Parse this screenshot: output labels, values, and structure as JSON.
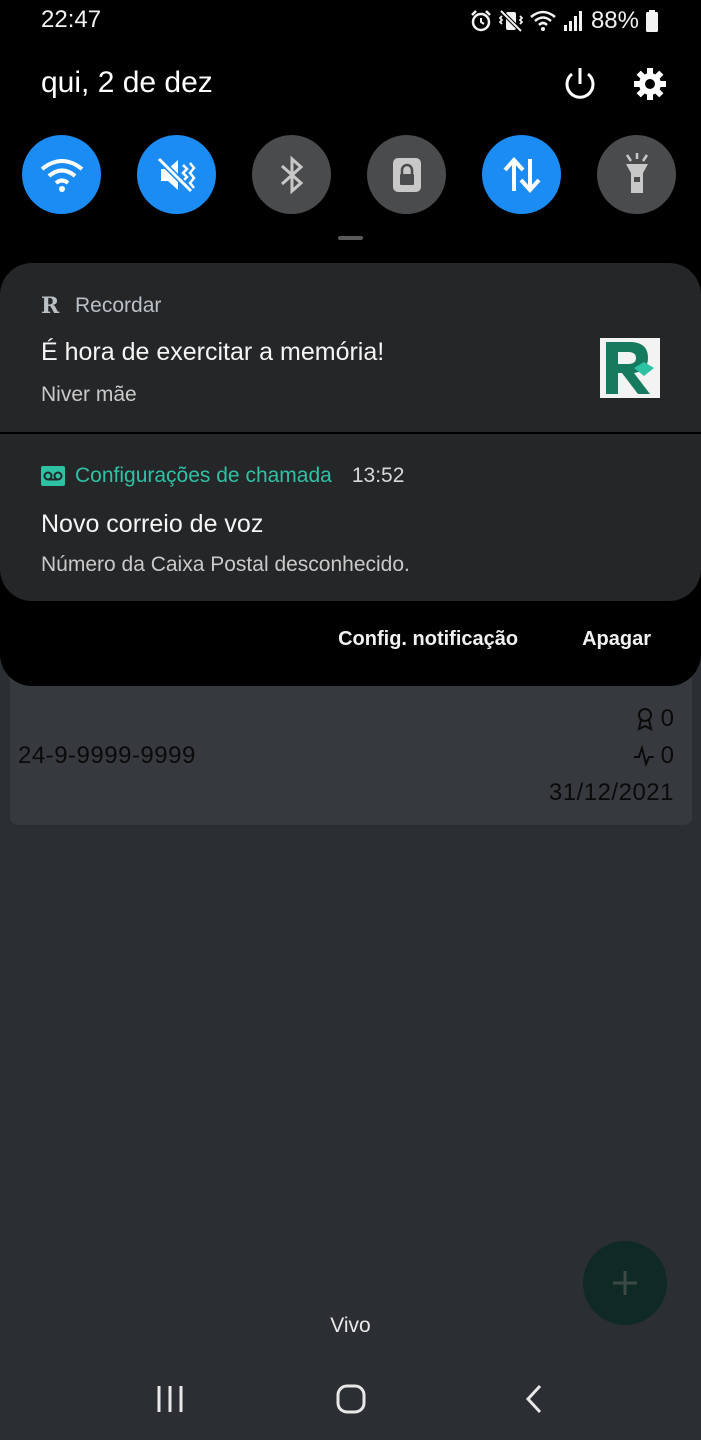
{
  "status_bar": {
    "time": "22:47",
    "battery": "88%",
    "icons": [
      "alarm-icon",
      "vibrate-icon",
      "wifi-icon",
      "signal-icon",
      "battery-icon"
    ]
  },
  "panel": {
    "date": "qui, 2 de dez",
    "quick_settings": [
      {
        "name": "wifi",
        "on": true
      },
      {
        "name": "sound-mute",
        "on": true
      },
      {
        "name": "bluetooth",
        "on": false
      },
      {
        "name": "screen-lock",
        "on": false
      },
      {
        "name": "mobile-data",
        "on": true
      },
      {
        "name": "flashlight",
        "on": false
      }
    ]
  },
  "notifications": [
    {
      "app": "Recordar",
      "app_icon_letter": "R",
      "title": "É hora de exercitar a memória!",
      "body": "Niver mãe"
    },
    {
      "app": "Configurações de chamada",
      "time": "13:52",
      "title": "Novo correio de voz",
      "body": "Número da Caixa Postal desconhecido."
    }
  ],
  "actions": {
    "settings": "Config. notificação",
    "clear": "Apagar"
  },
  "background_app": {
    "card": {
      "phone": "24-9-9999-9999",
      "award_count": "0",
      "activity_count": "0",
      "date": "31/12/2021"
    },
    "fab_icon": "plus-icon"
  },
  "carrier": "Vivo",
  "colors": {
    "accent_blue": "#1c8cf5",
    "teal": "#2ec2a5",
    "panel_bg": "#252628"
  }
}
